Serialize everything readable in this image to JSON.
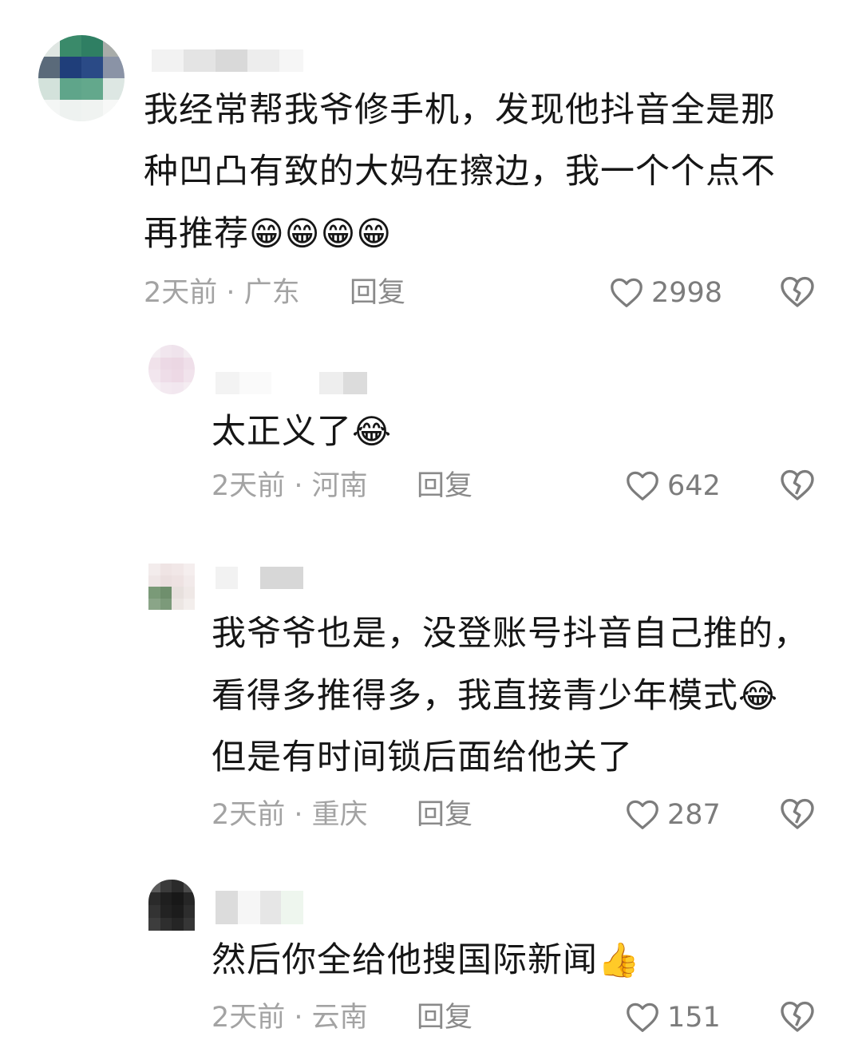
{
  "comments": [
    {
      "text_lines": [
        "我经常帮我爷修手机，发现他抖音全是那",
        "种凹凸有致的大妈在擦边，我一个个点不",
        "再推荐"
      ],
      "emoji": "😁😁😁😁",
      "time": "2天前",
      "location": "广东",
      "reply_label": "回复",
      "likes": "2998"
    },
    {
      "text_lines": [
        "太正义了"
      ],
      "emoji": "😂",
      "time": "2天前",
      "location": "河南",
      "reply_label": "回复",
      "likes": "642"
    },
    {
      "text_lines": [
        "我爷爷也是，没登账号抖音自己推的，",
        "看得多推得多，我直接青少年模式",
        "但是有时间锁后面给他关了"
      ],
      "emoji": "😂",
      "time": "2天前",
      "location": "重庆",
      "reply_label": "回复",
      "likes": "287"
    },
    {
      "text_lines": [
        "然后你全给他搜国际新闻"
      ],
      "emoji": "👍",
      "time": "2天前",
      "location": "云南",
      "reply_label": "回复",
      "likes": "151"
    }
  ],
  "meta_separator": " · ",
  "icons": {
    "like": "heart-outline-icon",
    "dislike": "broken-heart-icon"
  },
  "colors": {
    "text": "#161616",
    "meta": "#a3a3a3",
    "icon": "#7c7c7c"
  }
}
